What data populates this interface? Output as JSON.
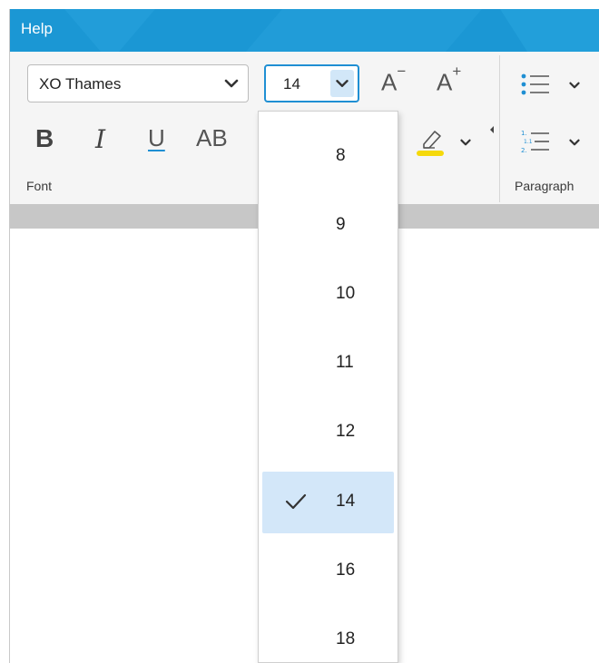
{
  "menubar": {
    "help_label": "Help"
  },
  "ribbon": {
    "font_name": "XO Thames",
    "font_size": "14",
    "decrease_font_label": "A",
    "increase_font_label": "A",
    "bold_label": "B",
    "italic_label": "I",
    "underline_label": "U",
    "caps_label": "AB",
    "font_group_label": "Font",
    "paragraph_group_label": "Paragraph",
    "highlight_color": "#f5d90a"
  },
  "size_dropdown": {
    "options": [
      "8",
      "9",
      "10",
      "11",
      "12",
      "14",
      "16",
      "18"
    ],
    "selected": "14"
  },
  "colors": {
    "accent": "#1b97d4",
    "selection": "#d3e7f9"
  }
}
